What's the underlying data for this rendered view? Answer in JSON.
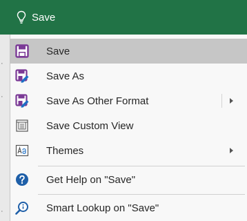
{
  "search": {
    "query": "Save",
    "bar_color": "#217346"
  },
  "menu": {
    "items": [
      {
        "label": "Save",
        "icon": "save-icon",
        "selected": true
      },
      {
        "label": "Save As",
        "icon": "save-as-icon"
      },
      {
        "label": "Save As Other Format",
        "icon": "save-as-other-format-icon",
        "submenu": true
      },
      {
        "label": "Save Custom View",
        "icon": "custom-view-icon"
      },
      {
        "label": "Themes",
        "icon": "themes-icon",
        "submenu": true
      },
      {
        "label": "Get Help on \"Save\"",
        "icon": "help-icon"
      },
      {
        "label": "Smart Lookup on \"Save\"",
        "icon": "smart-lookup-icon"
      }
    ],
    "accent_color": "#7b3a96",
    "help_color": "#1e5fa8"
  }
}
